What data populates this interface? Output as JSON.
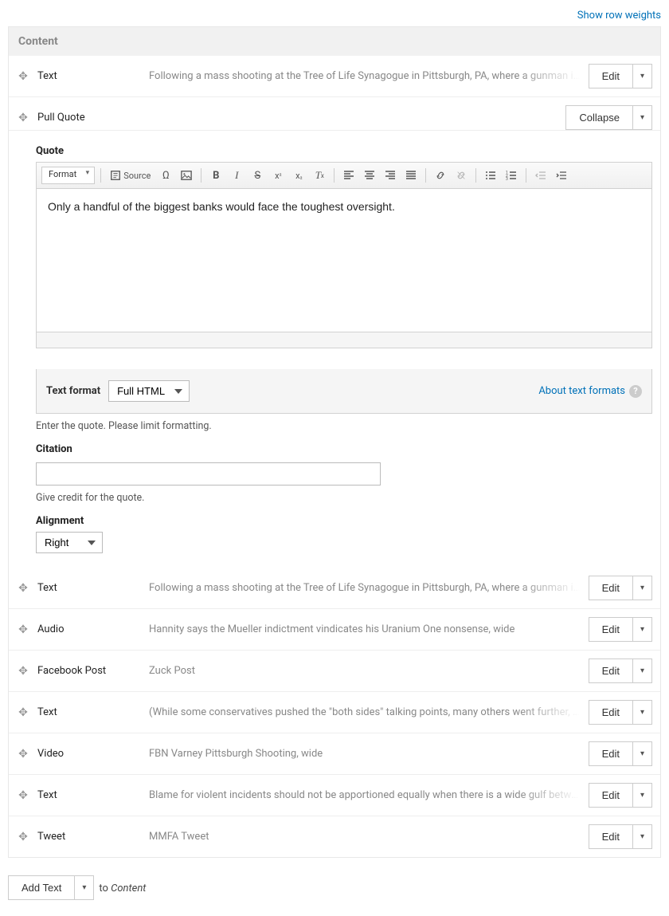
{
  "show_row_weights": "Show row weights",
  "content_header": "Content",
  "buttons": {
    "edit": "Edit",
    "collapse": "Collapse",
    "add_text": "Add Text"
  },
  "rows_before": [
    {
      "type": "Text",
      "preview": "Following a mass shooting at the Tree of Life Synagogue in Pittsburgh, PA, where a gunman insp"
    }
  ],
  "pull_quote": {
    "type": "Pull Quote",
    "quote_label": "Quote",
    "quote_text": "Only a handful of the biggest banks would face the toughest oversight.",
    "format_dropdown": "Format",
    "source_label": "Source",
    "text_format_label": "Text format",
    "text_format_value": "Full HTML",
    "about_formats": "About text formats",
    "quote_help": "Enter the quote. Please limit formatting.",
    "citation_label": "Citation",
    "citation_value": "",
    "citation_help": "Give credit for the quote.",
    "alignment_label": "Alignment",
    "alignment_value": "Right"
  },
  "rows_after": [
    {
      "type": "Text",
      "preview": "Following a mass shooting at the Tree of Life Synagogue in Pittsburgh, PA, where a gunman insp"
    },
    {
      "type": "Audio",
      "preview": "Hannity says the Mueller indictment vindicates his Uranium One nonsense, wide"
    },
    {
      "type": "Facebook Post",
      "preview": "Zuck Post"
    },
    {
      "type": "Text",
      "preview": "(While some conservatives pushed the \"both sides\" talking points, many others went further, ter"
    },
    {
      "type": "Video",
      "preview": "FBN Varney Pittsburgh Shooting, wide"
    },
    {
      "type": "Text",
      "preview": "Blame for violent incidents should not be apportioned equally when there is a wide gulf between"
    },
    {
      "type": "Tweet",
      "preview": "MMFA Tweet"
    }
  ],
  "add_text_suffix": {
    "to": "to",
    "target": "Content"
  }
}
